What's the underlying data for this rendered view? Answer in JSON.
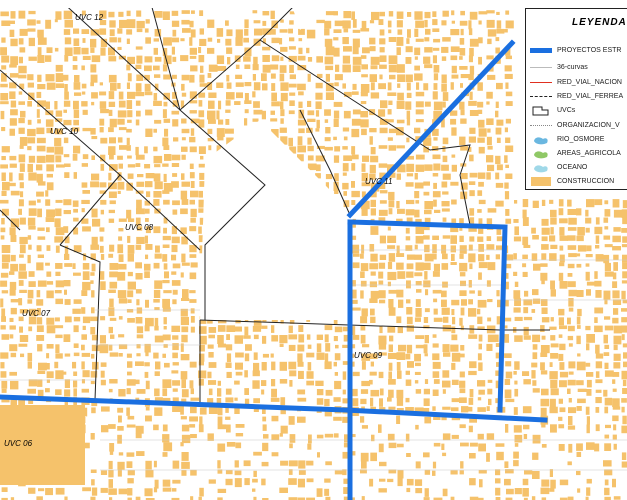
{
  "map": {
    "colors": {
      "construction": "#f5c26b",
      "project_line": "#1a6fe0",
      "road_network": "#e03020",
      "river": "#6ab7e0",
      "agricultural": "#8fc866",
      "ocean": "#9fd8e8",
      "boundary": "#222222"
    },
    "uvc_labels": {
      "uvc12": "UVC 12",
      "uvc10": "UVC 10",
      "uvc11": "UVC 11",
      "uvc08": "UVC 08",
      "uvc07": "UVC 07",
      "uvc09": "UVC 09",
      "uvc06": "UVC 06"
    }
  },
  "legend": {
    "title": "LEYENDA",
    "items": [
      {
        "label": "PROYECTOS ESTR",
        "icon": "thick-blue-line"
      },
      {
        "label": "36-curvas",
        "icon": "thin-gray-line"
      },
      {
        "label": "RED_VIAL_NACION",
        "icon": "red-line"
      },
      {
        "label": "RED_VIAL_FERREA",
        "icon": "dashed-black-line"
      },
      {
        "label": "UVCs",
        "icon": "outline-polygon"
      },
      {
        "label": "ORGANIZACION_V",
        "icon": "dotted-line"
      },
      {
        "label": "RIO_OSMORE",
        "icon": "blue-blob"
      },
      {
        "label": "AREAS_AGRICOLA",
        "icon": "green-blob"
      },
      {
        "label": "OCEANO",
        "icon": "cyan-blob"
      },
      {
        "label": "CONSTRUCCION",
        "icon": "orange-rect"
      }
    ]
  }
}
